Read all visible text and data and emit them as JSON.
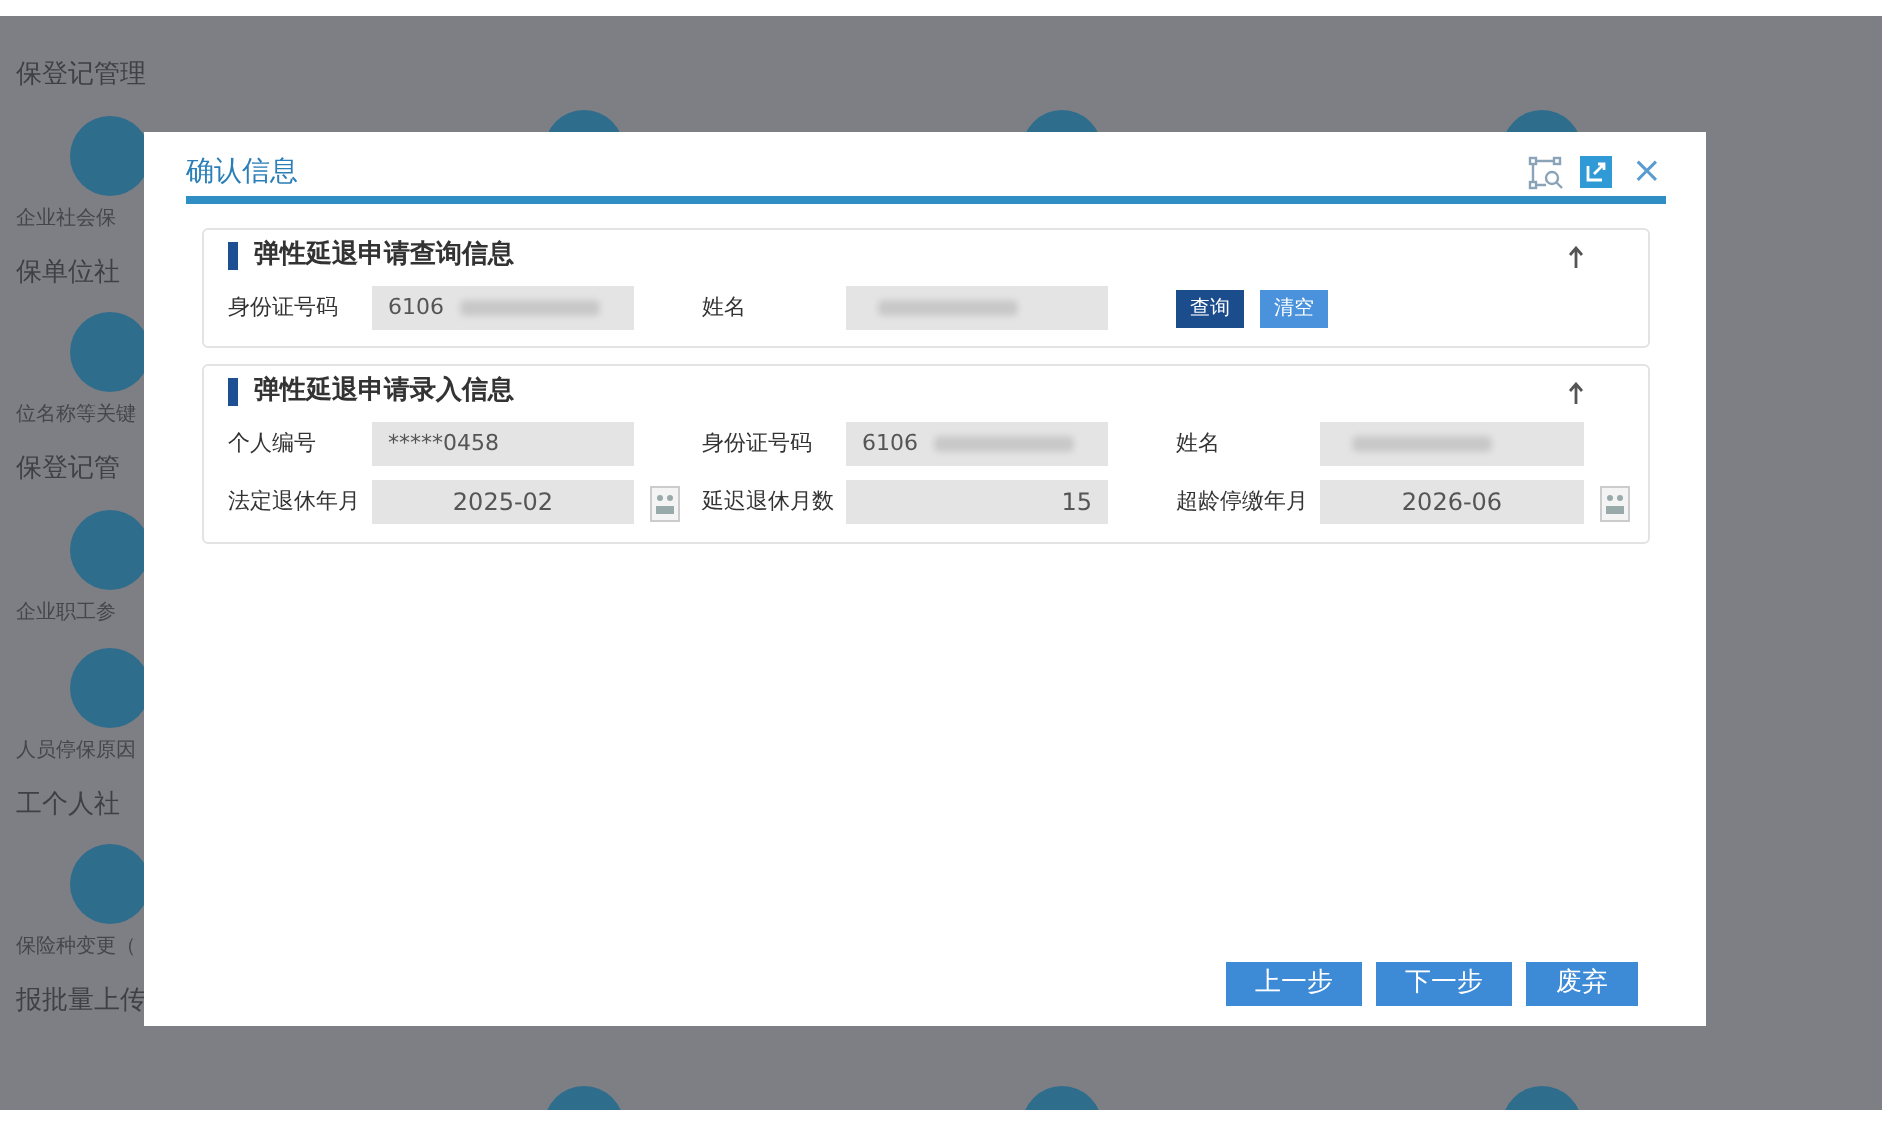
{
  "background": {
    "sections": [
      {
        "heading": "保登记管理",
        "items": [
          "企业社会保"
        ]
      },
      {
        "heading": "保单位社",
        "items": [
          "位名称等关键"
        ]
      },
      {
        "heading": "保登记管",
        "items": [
          "企业职工参",
          "人员停保原因"
        ]
      },
      {
        "heading": "工个人社",
        "items": [
          "保险种变更（"
        ]
      },
      {
        "heading": "报批量上传"
      }
    ]
  },
  "dialog": {
    "title": "确认信息",
    "close": "×",
    "panels": [
      {
        "title": "弹性延退申请查询信息",
        "fields": [
          {
            "label": "身份证号码",
            "value": "6106",
            "kind": "text",
            "redacted": true
          },
          {
            "label": "姓名",
            "kind": "text",
            "redacted": true
          }
        ],
        "buttons": [
          {
            "label": "查询",
            "kind": "primary"
          },
          {
            "label": "清空",
            "kind": "secondary"
          }
        ]
      },
      {
        "title": "弹性延退申请录入信息",
        "fields": [
          {
            "label": "个人编号",
            "value": "*****0458",
            "kind": "text",
            "redacted": false
          },
          {
            "label": "身份证号码",
            "value": "6106",
            "kind": "text",
            "redacted": true
          },
          {
            "label": "姓名",
            "kind": "text",
            "redacted": true
          },
          {
            "label": "法定退休年月",
            "value": "2025-02",
            "kind": "date",
            "redacted": false
          },
          {
            "label": "延迟退休月数",
            "value": "15",
            "kind": "number",
            "redacted": false
          },
          {
            "label": "超龄停缴年月",
            "value": "2026-06",
            "kind": "date",
            "redacted": false
          }
        ]
      }
    ],
    "footer_buttons": [
      "上一步",
      "下一步",
      "废弃"
    ]
  }
}
